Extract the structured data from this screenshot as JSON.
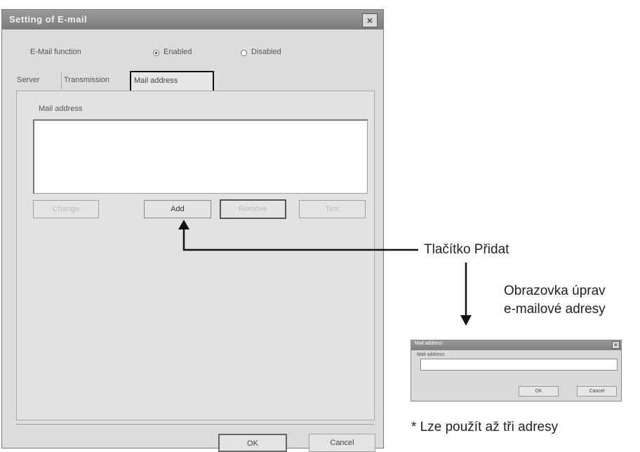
{
  "dialog": {
    "title": "Setting of E-mail",
    "close_glyph": "×",
    "email_function_label": "E-Mail function",
    "enabled_label": "Enabled",
    "disabled_label": "Disabled",
    "enabled_selected": true,
    "tabs": [
      {
        "label": "Server"
      },
      {
        "label": "Transmission"
      },
      {
        "label": "Mail address"
      }
    ],
    "active_tab": "Mail address",
    "mail_address_label": "Mail address",
    "buttons": {
      "left_disabled": "Change",
      "add": "Add",
      "focused": "Remove",
      "right_disabled": "Test"
    },
    "ok_label": "OK",
    "cancel_label": "Cancel"
  },
  "mini_dialog": {
    "title": "Mail address",
    "close_glyph": "×",
    "field_label": "Mail address",
    "input_value": "",
    "ok_label": "OK",
    "cancel_label": "Cancel"
  },
  "annotations": {
    "add_button_callout": "Tlačítko Přidat",
    "edit_screen_line1": "Obrazovka úprav",
    "edit_screen_line2": "e-mailové adresy",
    "footnote": "*  Lze použít až tři adresy"
  },
  "colors": {
    "title_bar": "#8a8a8a",
    "highlight_border": "#111111",
    "arrow": "#111111"
  }
}
